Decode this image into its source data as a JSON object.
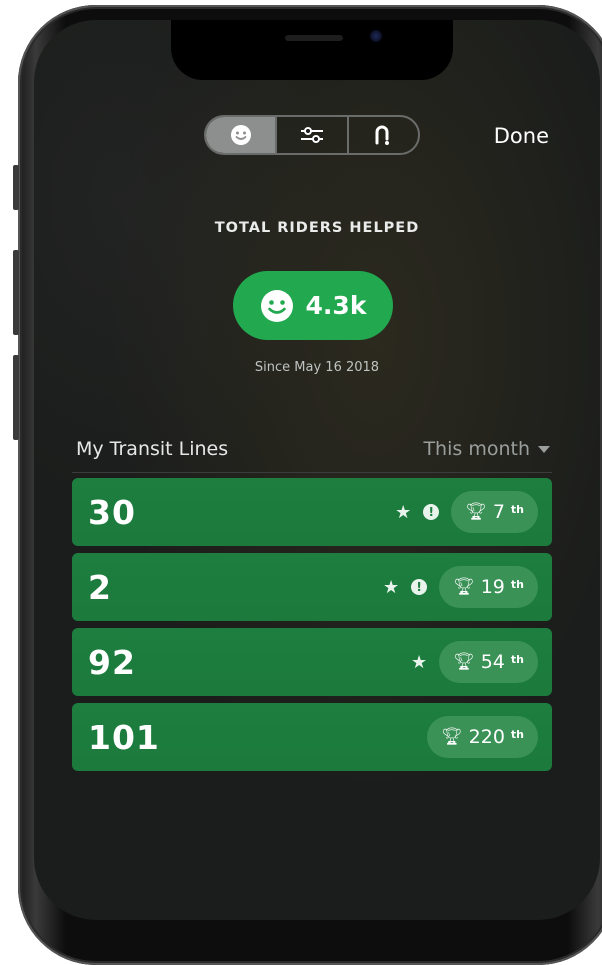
{
  "header": {
    "tabs": [
      {
        "icon": "smiley-icon",
        "selected": true
      },
      {
        "icon": "sliders-icon",
        "selected": false
      },
      {
        "icon": "route-icon",
        "selected": false
      }
    ],
    "done_label": "Done"
  },
  "summary": {
    "title": "TOTAL RIDERS HELPED",
    "value": "4.3k",
    "since": "Since May 16 2018"
  },
  "lines_section": {
    "title": "My Transit Lines",
    "period": "This month"
  },
  "lines": [
    {
      "number": "30",
      "rank": "7",
      "suffix": "th",
      "star": true,
      "feedback": true
    },
    {
      "number": "2",
      "rank": "19",
      "suffix": "th",
      "star": true,
      "feedback": true
    },
    {
      "number": "92",
      "rank": "54",
      "suffix": "th",
      "star": true,
      "feedback": false
    },
    {
      "number": "101",
      "rank": "220",
      "suffix": "th",
      "star": false,
      "feedback": false
    }
  ],
  "colors": {
    "accent_green": "#22a84f",
    "row_green": "#1d7e3f",
    "background": "#1b1d1c"
  }
}
